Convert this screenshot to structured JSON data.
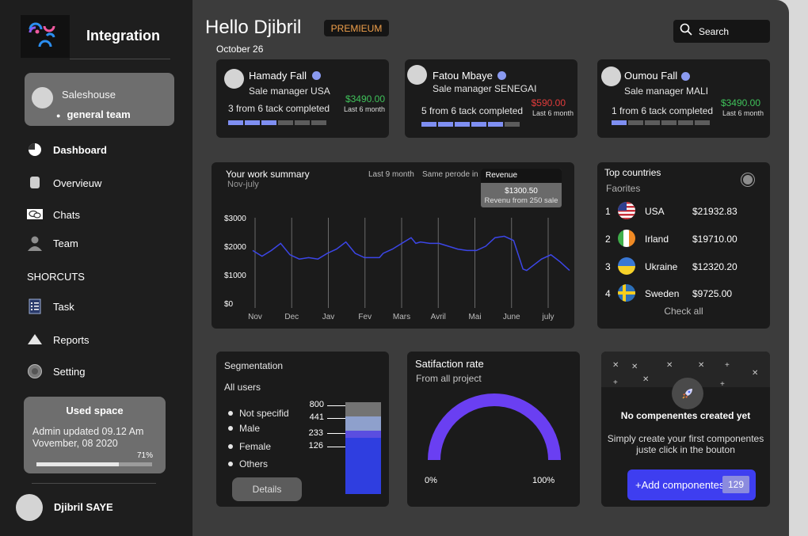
{
  "sidebar": {
    "app_title": "Integration",
    "team": {
      "name": "Saleshouse",
      "sub": "general team"
    },
    "nav": [
      {
        "label": "Dashboard",
        "icon": "pie-chart-icon",
        "active": true
      },
      {
        "label": "Overvieuw",
        "icon": "overview-icon"
      },
      {
        "label": "Chats",
        "icon": "chat-icon"
      },
      {
        "label": "Team",
        "icon": "team-icon"
      }
    ],
    "section_title": "SHORCUTS",
    "shortcuts": [
      {
        "label": "Task",
        "icon": "task-list-icon"
      },
      {
        "label": "Reports",
        "icon": "reports-icon"
      },
      {
        "label": "Setting",
        "icon": "settings-icon"
      }
    ],
    "used_space": {
      "title": "Used space",
      "line1": "Admin  updated 09.12 Am",
      "line2": "Vovember, 08 2020",
      "percent_label": "71%",
      "percent": 71
    },
    "user_name": "Djibril SAYE"
  },
  "header": {
    "greeting": "Hello Djibril",
    "badge": "PREMIEUM",
    "date": "October 26",
    "search_placeholder": "Search"
  },
  "people": [
    {
      "name": "Hamady Fall",
      "role": "Sale manager USA",
      "tasks": "3 from 6 tack completed",
      "amount": "$3490.00",
      "amount_color": "#3fc25a",
      "period": "Last 6 month",
      "completed": 3,
      "total": 6
    },
    {
      "name": "Fatou Mbaye",
      "role": "Sale manager SENEGAI",
      "tasks": "5 from 6 tack completed",
      "amount": "$590.00",
      "amount_color": "#e23b3b",
      "period": "Last 6 month",
      "completed": 5,
      "total": 6
    },
    {
      "name": "Oumou Fall",
      "role": "Sale manager MALI",
      "tasks": "1 from 6 tack completed",
      "amount": "$3490.00",
      "amount_color": "#3fc25a",
      "period": "Last 6 month",
      "completed": 1,
      "total": 6
    }
  ],
  "summary": {
    "title": "Your work summary",
    "subtitle": "Nov-july",
    "opt1": "Last 9 month",
    "opt2": "Same perode in",
    "tooltip": {
      "title": "Revenue",
      "value": "$1300.50",
      "sub": "Revenu from 250 sale"
    }
  },
  "chart_data": {
    "type": "line",
    "x": [
      0,
      0.5,
      1,
      1.5,
      2,
      2.5,
      3,
      3.5,
      4,
      4.5,
      5,
      5.5,
      6,
      6.5,
      6.8,
      7,
      7.5,
      8,
      8.5,
      8.75,
      9,
      9.5,
      10,
      10.5,
      11,
      11.5,
      12,
      12.5,
      13,
      13.5,
      14,
      14.5,
      14.7,
      15,
      15.5,
      16,
      16.5,
      17
    ],
    "y": [
      1850,
      1650,
      1850,
      2100,
      1700,
      1550,
      1600,
      1550,
      1750,
      1900,
      2150,
      1750,
      1600,
      1600,
      1600,
      1750,
      1900,
      2100,
      2300,
      2100,
      2150,
      2100,
      2100,
      2000,
      1900,
      1850,
      1850,
      2000,
      2300,
      2350,
      2200,
      1200,
      1150,
      1300,
      1550,
      1700,
      1450,
      1150
    ],
    "xticks": [
      "Nov",
      "Dec",
      "Jav",
      "Fev",
      "Mars",
      "Avril",
      "Mai",
      "June",
      "july"
    ],
    "yticks": [
      "$0",
      "$1000",
      "$2000",
      "$3000"
    ],
    "ylim": [
      0,
      3000
    ],
    "color": "#3c46e8",
    "grid": true
  },
  "countries": {
    "title": "Top countries",
    "subtitle": "Faorites",
    "rows": [
      {
        "rank": "1",
        "name": "USA",
        "value": "$21932.83",
        "flag": "us-flag-icon"
      },
      {
        "rank": "2",
        "name": "Irland",
        "value": "$19710.00",
        "flag": "ireland-flag-icon"
      },
      {
        "rank": "3",
        "name": "Ukraine",
        "value": "$12320.20",
        "flag": "ukraine-flag-icon"
      },
      {
        "rank": "4",
        "name": "Sweden",
        "value": "$9725.00",
        "flag": "sweden-flag-icon"
      }
    ],
    "check_all": "Check all"
  },
  "segmentation": {
    "title": "Segmentation",
    "subtitle": "All users",
    "legend": [
      "Not specifid",
      "Male",
      "Female",
      "Others"
    ],
    "values": [
      {
        "label": "800",
        "value": 800,
        "color": "#737373"
      },
      {
        "label": "441",
        "value": 441,
        "color": "#8ea0cc"
      },
      {
        "label": "233",
        "value": 233,
        "color": "#5a4ee0"
      },
      {
        "label": "126",
        "value": 126,
        "color": "#2f3ee0"
      }
    ],
    "details": "Details"
  },
  "satisfaction": {
    "title": "Satifaction rate",
    "subtitle": "From all project",
    "min": "0%",
    "max": "100%",
    "color": "#6a3ff2"
  },
  "components": {
    "heading": "No compenentes created yet",
    "text1": "Simply create your first  componentes",
    "text2": "juste click in the bouton",
    "button": "+Add componentes",
    "count": "129"
  }
}
